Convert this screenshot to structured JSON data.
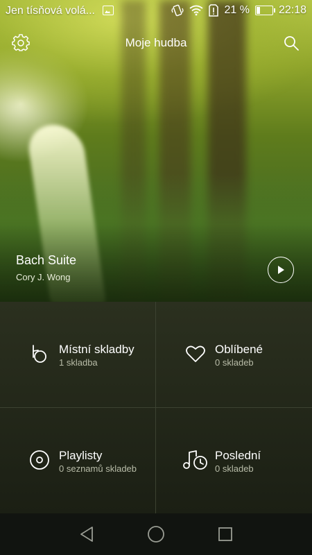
{
  "status_bar": {
    "carrier": "Jen tísňová volá...",
    "battery_text": "21 %",
    "battery_level": 0.21,
    "time": "22:18"
  },
  "header": {
    "title": "Moje hudba",
    "settings_icon": "gear-icon",
    "search_icon": "search-icon"
  },
  "now_playing": {
    "title": "Bach Suite",
    "artist": "Cory J. Wong",
    "play_icon": "play-icon"
  },
  "tiles": [
    {
      "label": "Místní skladby",
      "count": "1 skladba",
      "icon": "local-tracks-icon"
    },
    {
      "label": "Oblíbené",
      "count": "0 skladeb",
      "icon": "heart-icon"
    },
    {
      "label": "Playlisty",
      "count": "0 seznamů skladeb",
      "icon": "disc-icon"
    },
    {
      "label": "Poslední",
      "count": "0 skladeb",
      "icon": "recent-music-icon"
    }
  ],
  "navigation": {
    "back_icon": "back-icon",
    "home_icon": "home-icon",
    "recents_icon": "recents-icon"
  }
}
